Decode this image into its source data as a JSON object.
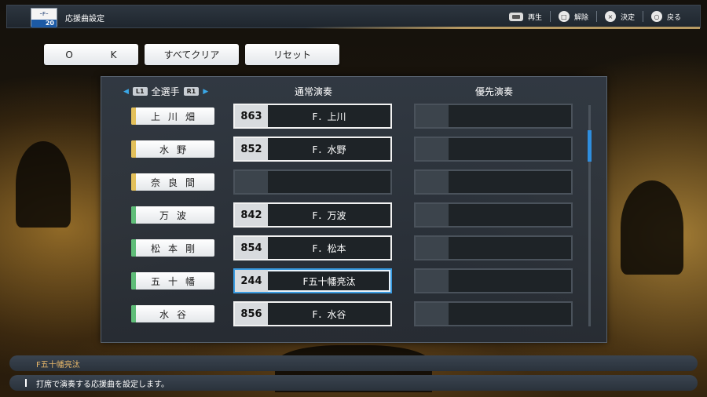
{
  "header": {
    "logo_text": "ｰFｰ",
    "logo_year": "20",
    "title": "応援曲設定",
    "controls": [
      {
        "icon": "touchpad-icon",
        "label": "再生"
      },
      {
        "icon": "square-button-icon",
        "symbol": "□",
        "label": "解除"
      },
      {
        "icon": "cross-button-icon",
        "symbol": "×",
        "label": "決定"
      },
      {
        "icon": "circle-button-icon",
        "symbol": "○",
        "label": "戻る"
      }
    ]
  },
  "actions": {
    "ok": "O K",
    "clear_all": "すべてクリア",
    "reset": "リセット"
  },
  "columns": {
    "l1": "L1",
    "players": "全選手",
    "r1": "R1",
    "normal": "通常演奏",
    "priority": "優先演奏"
  },
  "rows": [
    {
      "player": "上川畑",
      "tab_color": "yellow",
      "num": "863",
      "song": "F．上川"
    },
    {
      "player": "水野",
      "tab_color": "yellow",
      "num": "852",
      "song": "F．水野"
    },
    {
      "player": "奈良間",
      "tab_color": "yellow",
      "num": "",
      "song": ""
    },
    {
      "player": "万波",
      "tab_color": "green",
      "num": "842",
      "song": "F．万波"
    },
    {
      "player": "松本剛",
      "tab_color": "green",
      "num": "854",
      "song": "F．松本"
    },
    {
      "player": "五十幡",
      "tab_color": "green",
      "num": "244",
      "song": "F五十幡亮汰",
      "selected": true
    },
    {
      "player": "水谷",
      "tab_color": "green",
      "num": "856",
      "song": "F．水谷"
    }
  ],
  "colors": {
    "yellow_tab": "#e3c05a",
    "green_tab": "#5fbd78",
    "accent_blue": "#2f8ede",
    "song_text": "#e8b86a"
  },
  "footer": {
    "current_song": "F五十幡亮汰",
    "description": "打席で演奏する応援曲を設定します。"
  }
}
